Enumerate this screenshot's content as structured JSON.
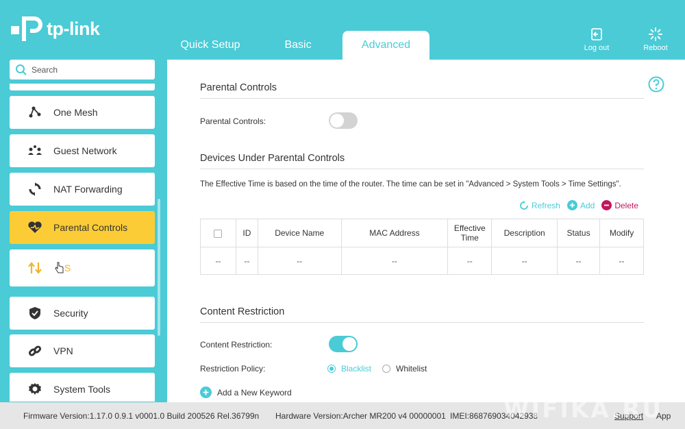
{
  "brand": {
    "name": "tp-link"
  },
  "tabs": [
    {
      "label": "Quick Setup"
    },
    {
      "label": "Basic"
    },
    {
      "label": "Advanced"
    }
  ],
  "header_buttons": {
    "logout": "Log out",
    "reboot": "Reboot"
  },
  "search": {
    "placeholder": "Search"
  },
  "sidebar": {
    "items": [
      {
        "label": "One Mesh",
        "icon": "mesh-icon"
      },
      {
        "label": "Guest Network",
        "icon": "guest-network-icon"
      },
      {
        "label": "NAT Forwarding",
        "icon": "nat-forwarding-icon"
      },
      {
        "label": "Parental Controls",
        "icon": "heart-icon",
        "active": true
      },
      {
        "label": "QoS",
        "icon": "qos-arrows-icon"
      },
      {
        "label": "Security",
        "icon": "shield-icon"
      },
      {
        "label": "VPN",
        "icon": "link-icon"
      },
      {
        "label": "System Tools",
        "icon": "gear-icon"
      }
    ],
    "qos_visible": "S"
  },
  "parental": {
    "section_title": "Parental Controls",
    "toggle_label": "Parental Controls:",
    "enabled": false
  },
  "devices": {
    "section_title": "Devices Under Parental Controls",
    "note": "The Effective Time is based on the time of the router. The time can be set in \"Advanced > System Tools > Time Settings\".",
    "actions": {
      "refresh": "Refresh",
      "add": "Add",
      "delete": "Delete"
    },
    "columns": [
      "ID",
      "Device Name",
      "MAC Address",
      "Effective Time",
      "Description",
      "Status",
      "Modify"
    ],
    "empty_row": [
      "--",
      "--",
      "--",
      "--",
      "--",
      "--",
      "--",
      "--"
    ]
  },
  "content": {
    "section_title": "Content Restriction",
    "toggle_label": "Content Restriction:",
    "enabled": true,
    "policy_label": "Restriction Policy:",
    "policy_options": [
      "Blacklist",
      "Whitelist"
    ],
    "policy_selected": "Blacklist",
    "add_keyword": "Add a New Keyword"
  },
  "footer": {
    "firmware": "Firmware Version:1.17.0 0.9.1 v0001.0 Build 200526 Rel.36799n",
    "hardware": "Hardware Version:Archer MR200 v4 00000001",
    "imei": "IMEI:868769034042938",
    "support": "Support",
    "app": "App"
  },
  "watermark": "WIFIKA.RU",
  "colors": {
    "accent": "#4acbd6",
    "active_item": "#fccc36",
    "delete": "#c2185b"
  }
}
